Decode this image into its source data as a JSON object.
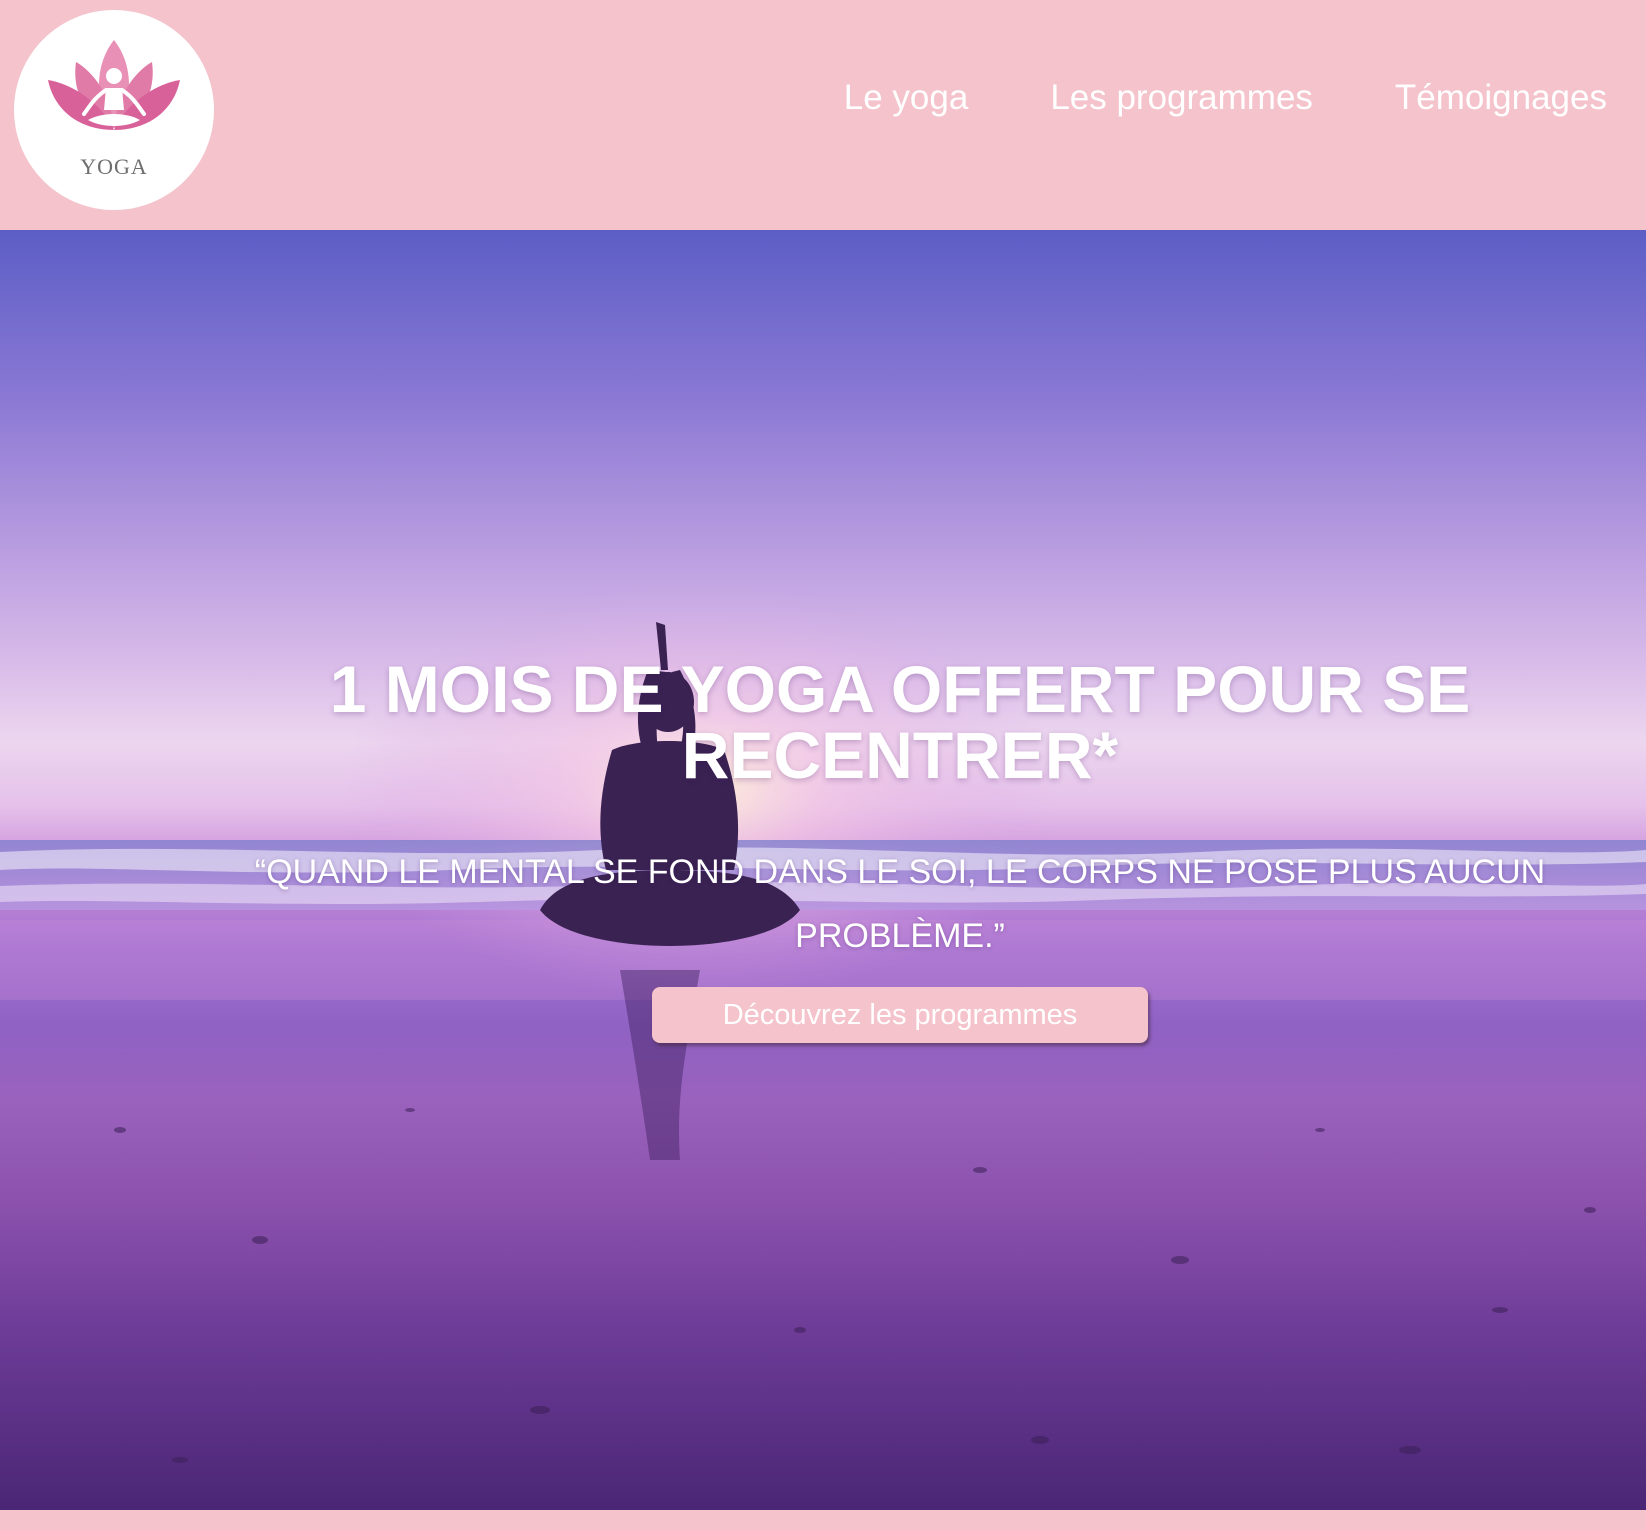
{
  "header": {
    "logo_text": "YOGA",
    "nav": [
      {
        "label": "Le yoga"
      },
      {
        "label": "Les programmes"
      },
      {
        "label": "Témoignages"
      }
    ]
  },
  "hero": {
    "title": "1 MOIS DE YOGA OFFERT POUR SE RECENTRER*",
    "quote": "“QUAND LE MENTAL SE FOND DANS LE SOI, LE CORPS NE POSE PLUS AUCUN PROBLÈME.”",
    "cta_label": "Découvrez les programmes"
  },
  "colors": {
    "brand_pink": "#f4c3cb",
    "text_white": "#ffffff",
    "logo_lotus": "#e07aa6"
  }
}
